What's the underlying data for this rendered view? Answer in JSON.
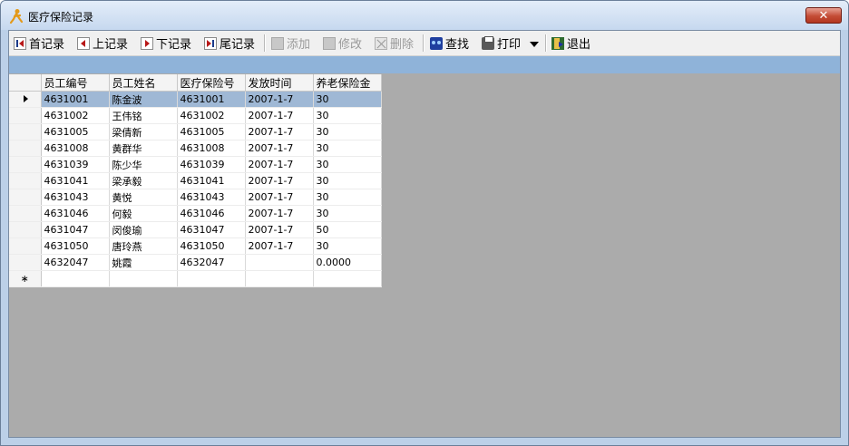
{
  "window": {
    "title": "医疗保险记录",
    "close_label": "✕"
  },
  "toolbar": {
    "first": "首记录",
    "prev": "上记录",
    "next": "下记录",
    "last": "尾记录",
    "add": "添加",
    "edit": "修改",
    "delete": "删除",
    "find": "查找",
    "print": "打印",
    "exit": "退出"
  },
  "grid": {
    "columns": [
      "员工编号",
      "员工姓名",
      "医疗保险号",
      "发放时间",
      "养老保险金"
    ],
    "new_row_marker": "∗",
    "rows": [
      [
        "4631001",
        "陈金波",
        "4631001",
        "2007-1-7",
        "30"
      ],
      [
        "4631002",
        "王伟铭",
        "4631002",
        "2007-1-7",
        "30"
      ],
      [
        "4631005",
        "梁倩新",
        "4631005",
        "2007-1-7",
        "30"
      ],
      [
        "4631008",
        "黄群华",
        "4631008",
        "2007-1-7",
        "30"
      ],
      [
        "4631039",
        "陈少华",
        "4631039",
        "2007-1-7",
        "30"
      ],
      [
        "4631041",
        "梁承毅",
        "4631041",
        "2007-1-7",
        "30"
      ],
      [
        "4631043",
        "黄悦",
        "4631043",
        "2007-1-7",
        "30"
      ],
      [
        "4631046",
        "何毅",
        "4631046",
        "2007-1-7",
        "30"
      ],
      [
        "4631047",
        "闵俊瑜",
        "4631047",
        "2007-1-7",
        "50"
      ],
      [
        "4631050",
        "唐玲燕",
        "4631050",
        "2007-1-7",
        "30"
      ],
      [
        "4632047",
        "姚霞",
        "4632047",
        "",
        "0.0000"
      ]
    ]
  },
  "colors": {
    "selected_row": "#9fb8d5",
    "band": "#8fb3d9",
    "workspace": "#ababab"
  }
}
